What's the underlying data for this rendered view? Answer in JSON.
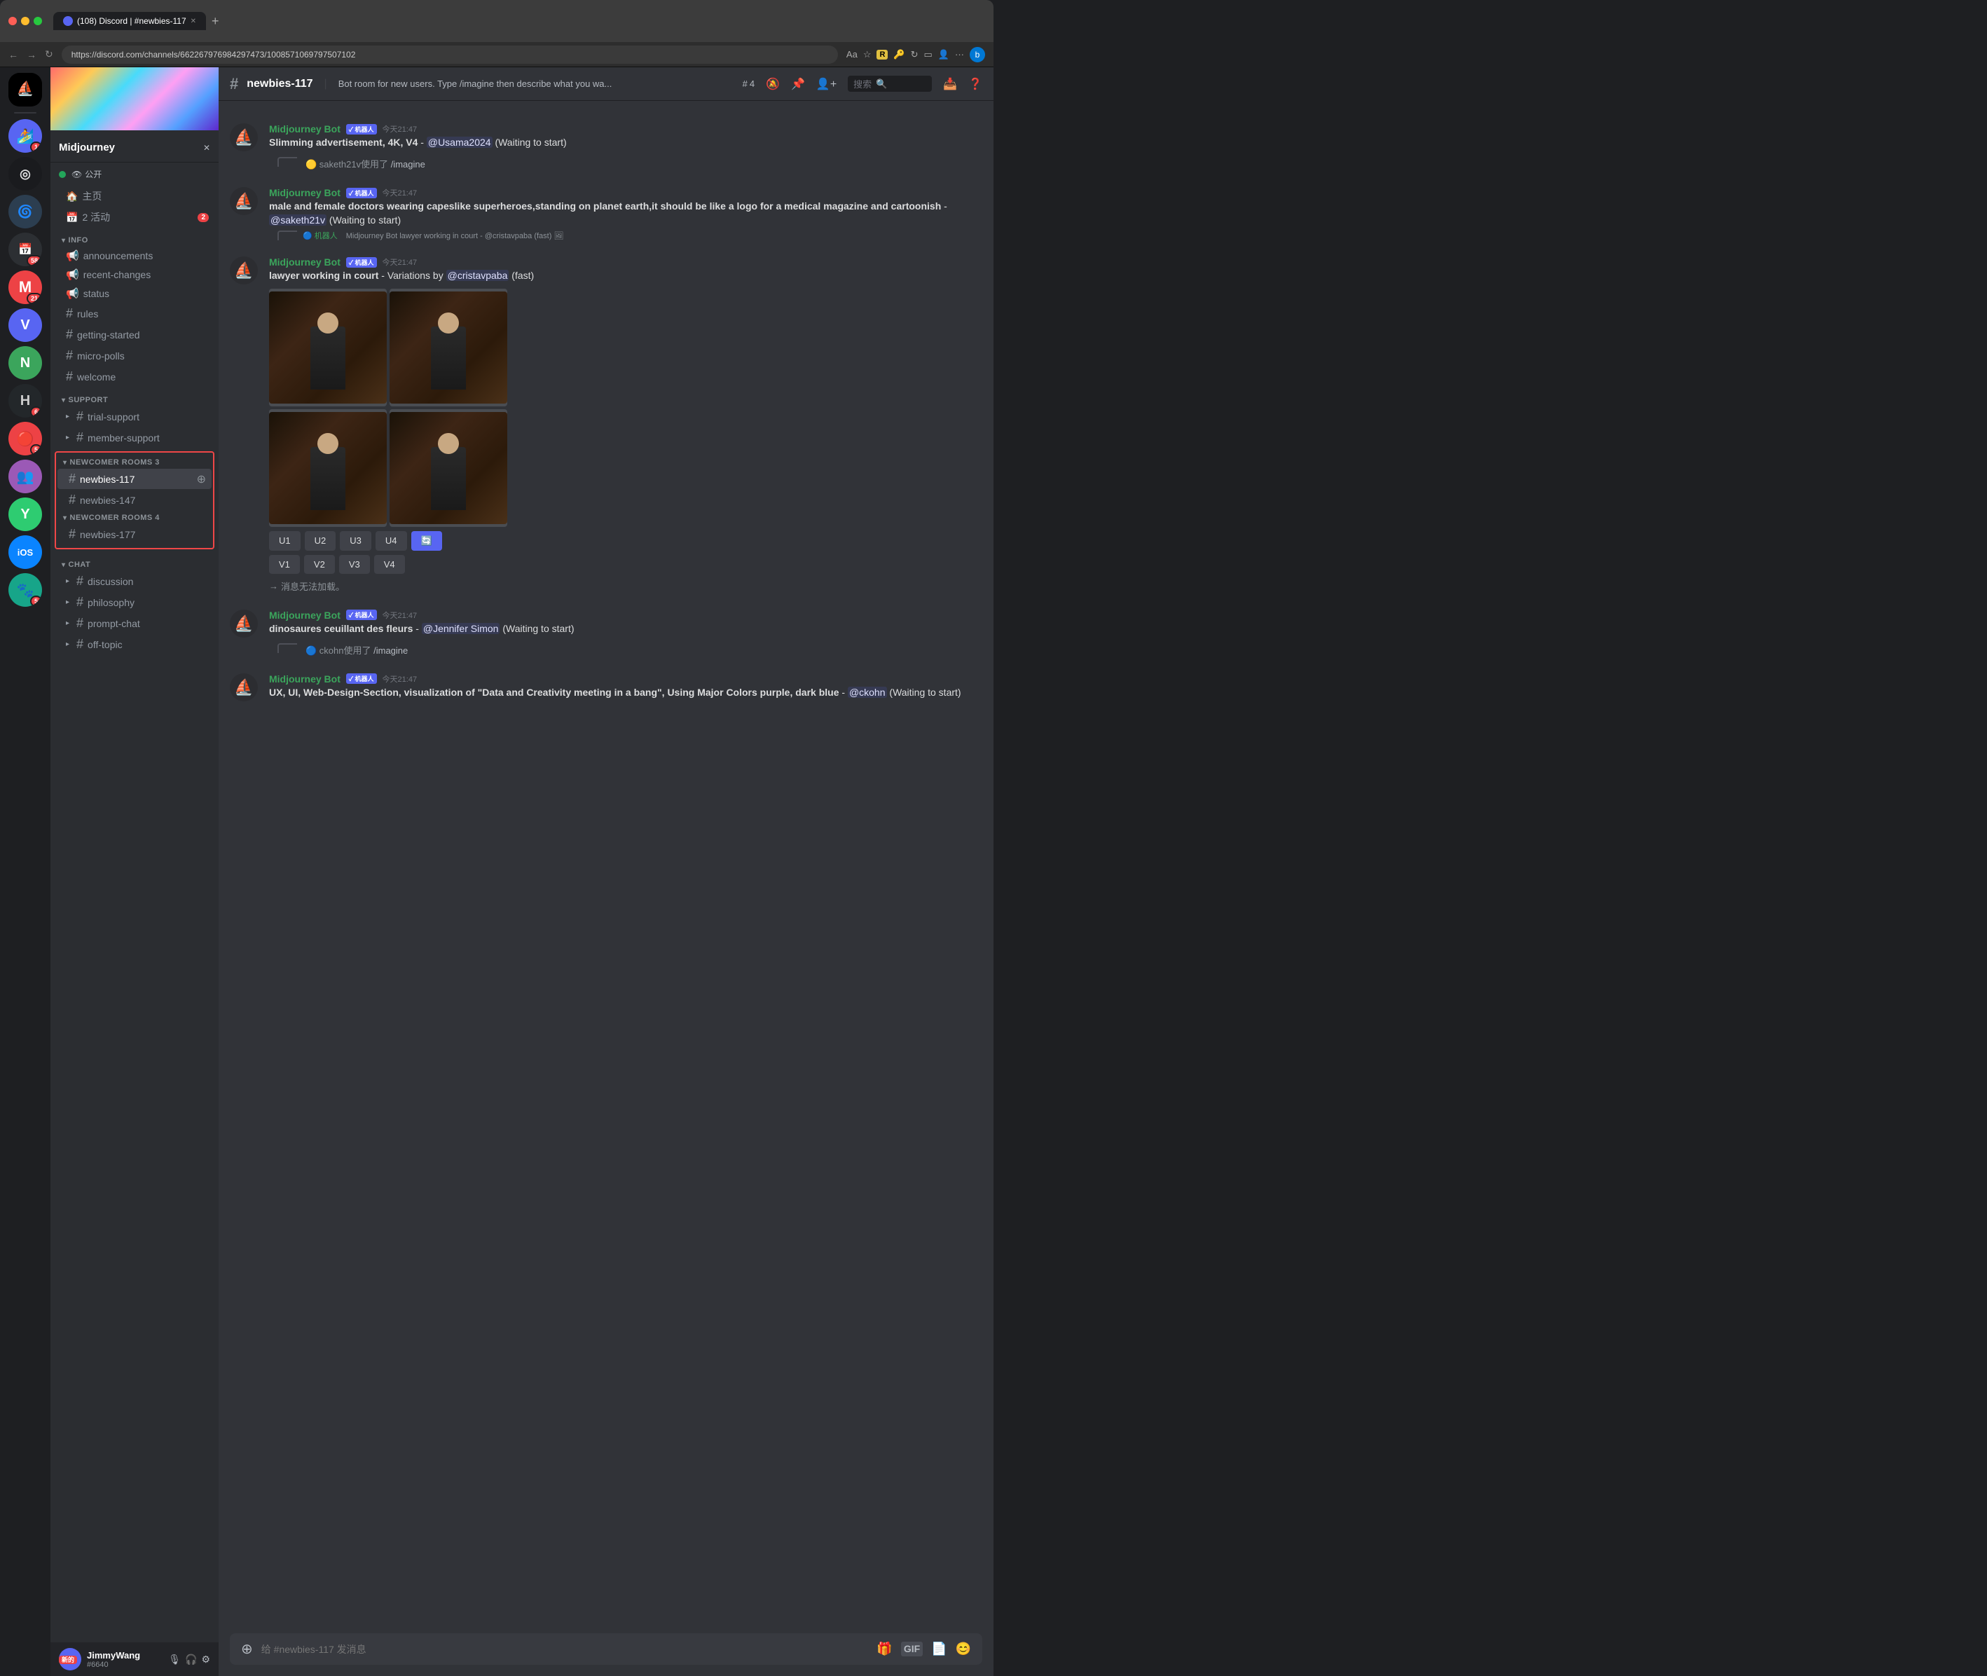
{
  "browser": {
    "tab_title": "(108) Discord | #newbies-117",
    "url": "https://discord.com/channels/662267976984297473/1008571069797507102",
    "new_tab_icon": "+",
    "back_icon": "←",
    "forward_icon": "→",
    "refresh_icon": "↻"
  },
  "server": {
    "name": "Midjourney",
    "visibility": "公开",
    "status_online": true
  },
  "channel_header": {
    "name": "newbies-117",
    "description": "Bot room for new users. Type /imagine then describe what you wa...",
    "member_count": "4",
    "search_placeholder": "搜索"
  },
  "sidebar": {
    "sections": [
      {
        "id": "info",
        "label": "INFO",
        "channels": [
          {
            "id": "announcements",
            "name": "announcements",
            "type": "announcement"
          },
          {
            "id": "recent-changes",
            "name": "recent-changes",
            "type": "announcement"
          },
          {
            "id": "status",
            "name": "status",
            "type": "announcement"
          },
          {
            "id": "rules",
            "name": "rules",
            "type": "hash"
          },
          {
            "id": "getting-started",
            "name": "getting-started",
            "type": "hash"
          },
          {
            "id": "micro-polls",
            "name": "micro-polls",
            "type": "hash"
          },
          {
            "id": "welcome",
            "name": "welcome",
            "type": "hash"
          }
        ]
      },
      {
        "id": "support",
        "label": "SUPPORT",
        "channels": [
          {
            "id": "trial-support",
            "name": "trial-support",
            "type": "hash",
            "collapsed": true
          },
          {
            "id": "member-support",
            "name": "member-support",
            "type": "hash",
            "collapsed": true
          }
        ]
      }
    ],
    "newcomer3": {
      "label": "NEWCOMER ROOMS 3",
      "channels": [
        {
          "id": "newbies-117",
          "name": "newbies-117",
          "type": "hash",
          "active": true
        },
        {
          "id": "newbies-147",
          "name": "newbies-147",
          "type": "hash"
        }
      ]
    },
    "newcomer4": {
      "label": "NEWCOMER ROOMS 4",
      "channels": [
        {
          "id": "newbies-177",
          "name": "newbies-177",
          "type": "hash"
        }
      ]
    },
    "chat_section": {
      "label": "CHAT",
      "channels": [
        {
          "id": "discussion",
          "name": "discussion",
          "type": "hash",
          "collapsed": true
        },
        {
          "id": "philosophy",
          "name": "philosophy",
          "type": "hash",
          "collapsed": true
        },
        {
          "id": "prompt-chat",
          "name": "prompt-chat",
          "type": "hash",
          "collapsed": true
        },
        {
          "id": "off-topic",
          "name": "off-topic",
          "type": "hash",
          "collapsed": true
        }
      ]
    }
  },
  "server_nav": {
    "home_label": "主页",
    "events_label": "2 活动",
    "events_count": "2"
  },
  "messages": [
    {
      "id": "msg1",
      "author": "Midjourney Bot",
      "author_color": "green",
      "badge": "机器人",
      "time": "今天21:47",
      "text": "Slimming advertisement, 4K, V4 - @Usama2024 (Waiting to start)",
      "mention": "@Usama2024",
      "waiting": "(Waiting to start)"
    },
    {
      "id": "sys1",
      "type": "system",
      "text": "saketh21v使用了 /imagine"
    },
    {
      "id": "msg2",
      "author": "Midjourney Bot",
      "author_color": "green",
      "badge": "机器人",
      "time": "今天21:47",
      "text": "male and female doctors wearing capeslike superheroes,standing on planet earth,it should be like a logo for a medical magazine and cartoonish - @saketh21v (Waiting to start)",
      "mention": "@saketh21v"
    },
    {
      "id": "reply1",
      "type": "reply",
      "replied_author": "机器人",
      "replied_text": "Midjourney Bot lawyer working in court - @cristavpaba (fast) 🖼"
    },
    {
      "id": "msg3",
      "author": "Midjourney Bot",
      "author_color": "green",
      "badge": "机器人",
      "time": "今天21:47",
      "text_bold": "lawyer working in court",
      "text_rest": " - Variations by @cristavpaba (fast)",
      "mention": "@cristavpaba",
      "has_image_grid": true
    },
    {
      "id": "buttons1",
      "type": "buttons",
      "u_buttons": [
        "U1",
        "U2",
        "U3",
        "U4"
      ],
      "v_buttons": [
        "V1",
        "V2",
        "V3",
        "V4"
      ],
      "refresh_active": true
    },
    {
      "id": "err1",
      "type": "error",
      "text": "→ 消息无法加载。"
    },
    {
      "id": "msg4",
      "author": "Midjourney Bot",
      "author_color": "green",
      "badge": "机器人",
      "time": "今天21:47",
      "text_bold": "dinosaures ceuillant des fleurs",
      "text_rest": " - @Jennifer Simon (Waiting to start)",
      "mention": "@Jennifer Simon"
    },
    {
      "id": "sys2",
      "type": "system",
      "text": "ckohn使用了 /imagine"
    },
    {
      "id": "msg5",
      "author": "Midjourney Bot",
      "author_color": "green",
      "badge": "机器人",
      "time": "今天21:47",
      "text": "UX, UI, Web-Design-Section, visualization of \"Data and Creativity meeting in a bang\", Using Major Colors purple, dark blue - @ckohn (Waiting to start)",
      "mention": "@ckohn"
    }
  ],
  "user_panel": {
    "name": "JimmyWang",
    "tag": "#6640",
    "new_badge": "新的"
  },
  "chat_input": {
    "placeholder": "给 #newbies-117 发消息"
  },
  "servers": [
    {
      "id": "midjourney",
      "label": "M",
      "style": "si-midjourney",
      "active": true
    },
    {
      "id": "s2",
      "label": "🏄",
      "style": "si-blue",
      "badge": "1"
    },
    {
      "id": "s3",
      "label": "◎",
      "style": "si-dark"
    },
    {
      "id": "s4",
      "label": "🌀",
      "style": "si-teal"
    },
    {
      "id": "s5",
      "label": "📅",
      "style": "si-dark",
      "badge": "58"
    },
    {
      "id": "s6",
      "label": "M",
      "style": "si-red",
      "badge": "21"
    },
    {
      "id": "s7",
      "label": "V",
      "style": "si-blue"
    },
    {
      "id": "s8",
      "label": "N",
      "style": "si-blue"
    },
    {
      "id": "s9",
      "label": "H",
      "style": "si-dark2",
      "badge": "6"
    },
    {
      "id": "s10",
      "label": "🔴",
      "style": "si-red",
      "badge": "5"
    },
    {
      "id": "s11",
      "label": "👥",
      "style": "si-purple"
    },
    {
      "id": "s12",
      "label": "Y",
      "style": "si-green"
    },
    {
      "id": "ios",
      "label": "iOS",
      "style": "si-ios"
    },
    {
      "id": "s14",
      "label": "🐾",
      "style": "si-teal",
      "badge": "5"
    }
  ]
}
